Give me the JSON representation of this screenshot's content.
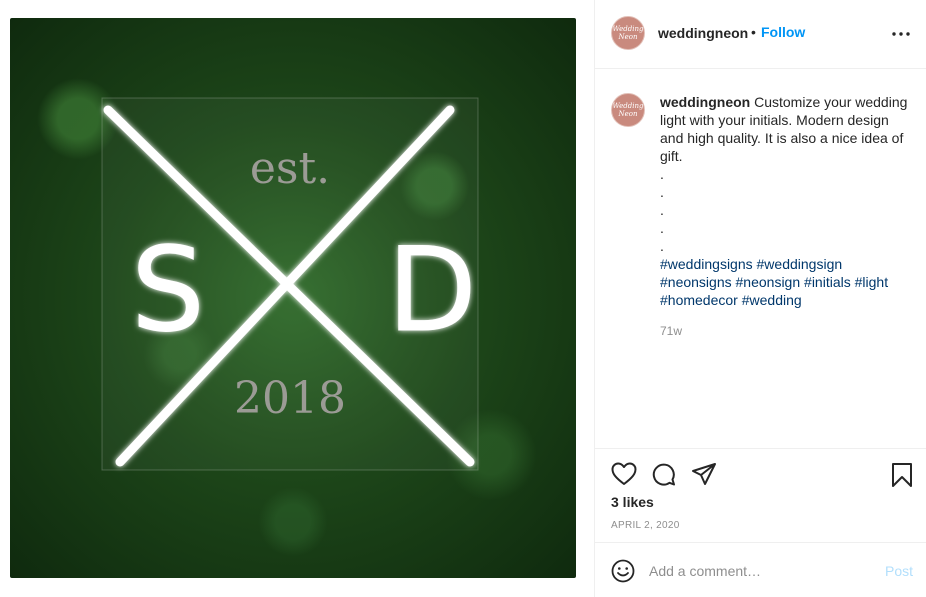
{
  "post": {
    "username": "weddingneon",
    "follow_label": "Follow",
    "dot_separator": "•",
    "avatar_text": "Wedding Neon",
    "more_glyph": "•••",
    "caption_text": "Customize your wedding light with your initials. Modern design and high quality. It is also a nice idea of gift.",
    "caption_dots": [
      ".",
      ".",
      ".",
      ".",
      "."
    ],
    "hashtags": [
      "#weddingsigns",
      "#weddingsign",
      "#neonsigns",
      "#neonsign",
      "#initials",
      "#light",
      "#homedecor",
      "#wedding"
    ],
    "time_ago": "71w",
    "likes": "3 likes",
    "date": "APRIL 2, 2020"
  },
  "photo": {
    "text_top": "est.",
    "letter_left": "S",
    "letter_right": "D",
    "text_bottom": "2018"
  },
  "actions": {
    "icons": [
      "heart-icon",
      "comment-icon",
      "share-icon",
      "bookmark-icon"
    ]
  },
  "comment": {
    "placeholder": "Add a comment…",
    "post_label": "Post",
    "emoji_icon": "emoji-icon"
  },
  "colors": {
    "follow": "#0095f6",
    "hashtag": "#00376b",
    "post_disabled": "#b2dffc",
    "avatar": "#c98a7e"
  }
}
